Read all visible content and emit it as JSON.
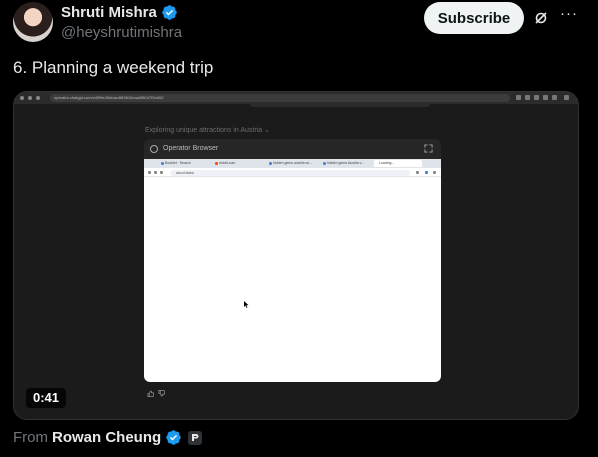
{
  "author": {
    "display_name": "Shruti Mishra",
    "handle": "@heyshrutimishra"
  },
  "actions": {
    "subscribe_label": "Subscribe",
    "more_label": "···"
  },
  "tweet": {
    "text": "6. Planning a weekend trip"
  },
  "media": {
    "browser_url": "operator.chatgpt.com/c/0f9fe43ebac4f83810eaa2f8047f3d402",
    "subtitle": "Exploring unique attractions in Austria ⌄",
    "operator_title": "Operator Browser",
    "tabs": [
      {
        "label": "Booklet · Search",
        "color": "#4a7bd0"
      },
      {
        "label": "reddit.com",
        "color": "#ff4500"
      },
      {
        "label": "hidden gems austria wi...",
        "color": "#4a7bd0"
      },
      {
        "label": "hidden gems Austria v...",
        "color": "#4a7bd0"
      },
      {
        "label": "Loading...",
        "color": "#999999"
      }
    ],
    "address": "about:blank",
    "duration": "0:41"
  },
  "attribution": {
    "from_label": "From",
    "from_name": "Rowan Cheung"
  },
  "colors": {
    "verified": "#1d9bf0",
    "background": "#000000"
  }
}
